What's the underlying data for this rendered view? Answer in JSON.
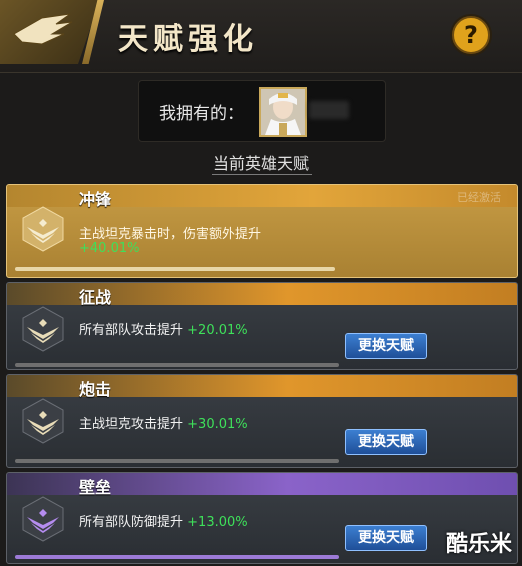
{
  "header": {
    "title": "天赋强化",
    "help_label": "?"
  },
  "owner": {
    "label": "我拥有的："
  },
  "section_title": "当前英雄天赋",
  "talents": [
    {
      "name": "冲锋",
      "description": "主战坦克暴击时，伤害额外提升",
      "value": "+40.01%",
      "badge": "已经激活",
      "theme": "gold",
      "active": true,
      "progress": 1.0
    },
    {
      "name": "征战",
      "description": "所有部队攻击提升",
      "value": "+20.01%",
      "button": "更换天赋",
      "theme": "gold",
      "progress": 1.0
    },
    {
      "name": "炮击",
      "description": "主战坦克攻击提升",
      "value": "+30.01%",
      "button": "更换天赋",
      "theme": "gold",
      "progress": 1.0
    },
    {
      "name": "壁垒",
      "description": "所有部队防御提升",
      "value": "+13.00%",
      "button": "更换天赋",
      "theme": "purple",
      "progress": 1.0
    }
  ],
  "watermark": "酷乐米"
}
